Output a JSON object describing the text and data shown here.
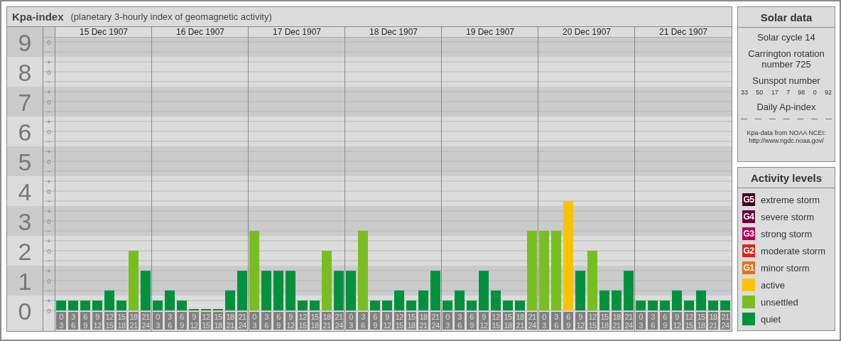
{
  "kpa_panel": {
    "title": "Kpa-index",
    "subtitle": "(planetary 3-hourly index of geomagnetic activity)",
    "dates": [
      "15 Dec 1907",
      "16 Dec 1907",
      "17 Dec 1907",
      "18 Dec 1907",
      "19 Dec 1907",
      "20 Dec 1907",
      "21 Dec 1907"
    ],
    "kp_sublevel_marks": [
      [
        "o",
        "−"
      ],
      [
        "+",
        "o",
        "−"
      ],
      [
        "+",
        "o",
        "−"
      ],
      [
        "+",
        "o",
        "−"
      ],
      [
        "+",
        "o",
        "−"
      ],
      [
        "+",
        "o",
        "−"
      ],
      [
        "+",
        "o",
        "−"
      ],
      [
        "+",
        "o",
        "−"
      ],
      [
        "+",
        "o",
        "−"
      ],
      [
        "+",
        "o"
      ]
    ],
    "chart_data": {
      "type": "bar",
      "stacked": true,
      "ylim": [
        0,
        9
      ],
      "grid": true,
      "yticks": [
        {
          "value": 9,
          "label": "9"
        },
        {
          "value": 8,
          "label": "8"
        },
        {
          "value": 7,
          "label": "7"
        },
        {
          "value": 6,
          "label": "6"
        },
        {
          "value": 5,
          "label": "5"
        },
        {
          "value": 4,
          "label": "4"
        },
        {
          "value": 3,
          "label": "3"
        },
        {
          "value": 2,
          "label": "2"
        },
        {
          "value": 1,
          "label": "1"
        },
        {
          "value": 0,
          "label": "0"
        }
      ],
      "categories": [
        "0 3",
        "3 6",
        "6 9",
        "9 12",
        "12 15",
        "15 18",
        "18 21",
        "21 24",
        "0 3",
        "3 6",
        "6 9",
        "9 12",
        "12 15",
        "15 18",
        "18 21",
        "21 24",
        "0 3",
        "3 6",
        "6 9",
        "9 12",
        "12 15",
        "15 18",
        "18 21",
        "21 24",
        "0 3",
        "3 6",
        "6 9",
        "9 12",
        "12 15",
        "15 18",
        "18 21",
        "21 24",
        "0 3",
        "3 6",
        "6 9",
        "9 12",
        "12 15",
        "15 18",
        "18 21",
        "21 24",
        "0 3",
        "3 6",
        "6 9",
        "9 12",
        "12 15",
        "15 18",
        "18 21",
        "21 24",
        "0 3",
        "3 6",
        "6 9",
        "9 12",
        "12 15",
        "15 18",
        "18 21",
        "21 24"
      ],
      "series": [
        {
          "name": "active",
          "color": "#f8c400",
          "values": [
            null,
            null,
            null,
            null,
            null,
            null,
            null,
            null,
            null,
            null,
            null,
            null,
            null,
            null,
            null,
            null,
            null,
            null,
            null,
            null,
            null,
            null,
            null,
            null,
            null,
            null,
            null,
            null,
            null,
            null,
            null,
            null,
            null,
            null,
            null,
            null,
            null,
            null,
            null,
            null,
            null,
            null,
            3.67,
            null,
            null,
            null,
            null,
            null,
            null,
            null,
            null,
            null,
            null,
            null,
            null,
            null
          ]
        },
        {
          "name": "unsettled",
          "color": "#78be20",
          "values": [
            null,
            null,
            null,
            null,
            null,
            null,
            2,
            null,
            null,
            null,
            null,
            null,
            null,
            null,
            null,
            null,
            2.67,
            null,
            null,
            null,
            null,
            null,
            2,
            null,
            null,
            2.67,
            null,
            null,
            null,
            null,
            null,
            null,
            null,
            null,
            null,
            null,
            null,
            null,
            null,
            2.67,
            2.67,
            2.67,
            null,
            null,
            2,
            null,
            null,
            null,
            null,
            null,
            null,
            null,
            null,
            null,
            null,
            null
          ]
        },
        {
          "name": "quiet",
          "color": "#00913f",
          "values": [
            0.33,
            0.33,
            0.33,
            0.33,
            0.67,
            0.33,
            null,
            1.33,
            0.33,
            0.67,
            0.33,
            0,
            0,
            0,
            0.67,
            1.33,
            null,
            1.33,
            1.33,
            1.33,
            0.33,
            0.33,
            null,
            1.33,
            1.33,
            null,
            0.33,
            0.33,
            0.67,
            0.33,
            0.67,
            1.33,
            0.33,
            0.67,
            0.33,
            1.33,
            0.67,
            0.33,
            0.33,
            null,
            null,
            null,
            null,
            1.33,
            null,
            0.67,
            0.67,
            1.33,
            0.33,
            0.33,
            0.33,
            0.67,
            0.33,
            0.67,
            0.33,
            0.33
          ]
        }
      ]
    }
  },
  "solar_data": {
    "title": "Solar data",
    "solar_cycle": "Solar cycle 14",
    "carrington": "Carrington rotation number 725",
    "sunspot_title": "Sunspot number",
    "sunspot_numbers": [
      "33",
      "50",
      "17",
      "7",
      "98",
      "0",
      "92"
    ],
    "ap_title": "Daily Ap-index",
    "ap_values": [
      "—",
      "—",
      "—",
      "—",
      "—",
      "—",
      "—"
    ],
    "source": "Kpa-data from NOAA NCEI: http://www.ngdc.noaa.gov/"
  },
  "activity_levels": {
    "title": "Activity levels",
    "storm_items": [
      {
        "badge": "G5",
        "label": "extreme storm",
        "color": "#4a0022"
      },
      {
        "badge": "G4",
        "label": "severe storm",
        "color": "#6a003a"
      },
      {
        "badge": "G3",
        "label": "strong storm",
        "color": "#b0005e"
      },
      {
        "badge": "G2",
        "label": "moderate storm",
        "color": "#d82a1c"
      },
      {
        "badge": "G1",
        "label": "minor storm",
        "color": "#e2731a"
      }
    ]
  }
}
